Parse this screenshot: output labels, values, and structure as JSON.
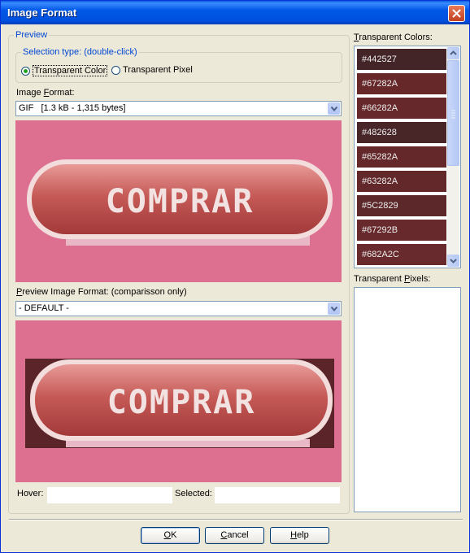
{
  "window": {
    "title": "Image Format"
  },
  "preview_group": {
    "legend": "Preview",
    "selection_group": {
      "legend": "Selection type: (double-click)",
      "options": [
        {
          "label": "Transparent Color",
          "selected": true
        },
        {
          "label": "Transparent Pixel",
          "selected": false
        }
      ]
    },
    "image_format": {
      "label_prefix": "Image ",
      "label_accel": "F",
      "label_suffix": "ormat:",
      "value": "GIF   [1.3 kB - 1,315 bytes]"
    },
    "preview_format": {
      "label_accel": "P",
      "label_suffix": "review Image Format: (comparisson only)",
      "value": "- DEFAULT -"
    },
    "button_text": "COMPRAR",
    "preview_bg": "#DD7090",
    "hover_label": "Hover:",
    "hover_value": "",
    "selected_label": "Selected:",
    "selected_value": ""
  },
  "transparent_colors": {
    "label_accel": "T",
    "label_suffix": "ransparent Colors:",
    "items": [
      {
        "hex": "#442527"
      },
      {
        "hex": "#67282A"
      },
      {
        "hex": "#66282A"
      },
      {
        "hex": "#482628"
      },
      {
        "hex": "#65282A"
      },
      {
        "hex": "#63282A"
      },
      {
        "hex": "#5C2829"
      },
      {
        "hex": "#67292B"
      },
      {
        "hex": "#682A2C"
      }
    ]
  },
  "transparent_pixels": {
    "label_prefix": "Transparent ",
    "label_accel": "P",
    "label_suffix": "ixels:"
  },
  "buttons": {
    "ok_accel": "O",
    "ok_rest": "K",
    "cancel_accel": "C",
    "cancel_rest": "ancel",
    "help_accel": "H",
    "help_rest": "elp"
  }
}
